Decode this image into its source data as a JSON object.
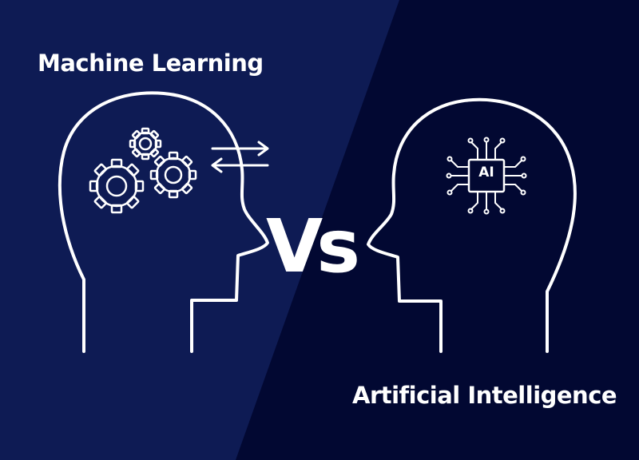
{
  "colors": {
    "background_light": "#0e1b54",
    "background_dark": "#020832",
    "line": "#ffffff"
  },
  "labels": {
    "left_title": "Machine Learning",
    "right_title": "Artificial Intelligence",
    "versus": "Vs",
    "chip": "AI"
  },
  "icons": {
    "left_head": "human-head-profile-icon",
    "right_head": "human-head-profile-icon",
    "gears": "gears-icon",
    "exchange": "exchange-arrows-icon",
    "chip": "ai-chip-icon"
  }
}
